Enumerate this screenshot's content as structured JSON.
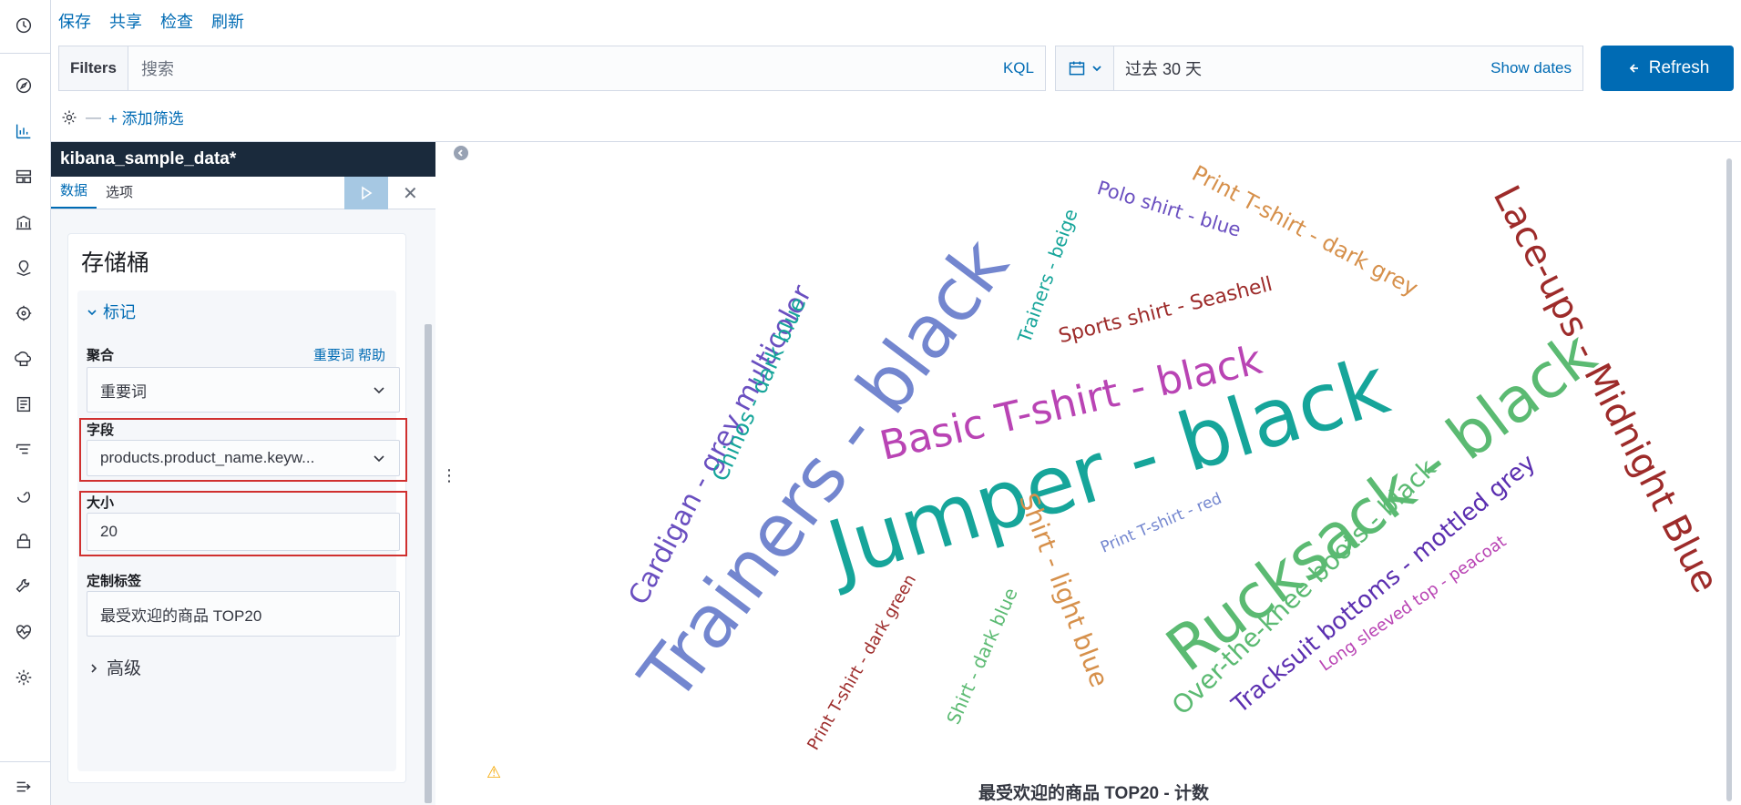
{
  "menu": {
    "save": "保存",
    "share": "共享",
    "inspect": "检查",
    "refresh": "刷新"
  },
  "query": {
    "filters_label": "Filters",
    "search_placeholder": "搜索",
    "kql": "KQL"
  },
  "date": {
    "range": "过去 30 天",
    "show_dates": "Show dates"
  },
  "refresh_button": "Refresh",
  "filter_row": {
    "add_filter": "+ 添加筛选"
  },
  "sidebar": {
    "title": "kibana_sample_data*",
    "tabs": [
      "数据",
      "选项"
    ],
    "section_title": "存储桶",
    "accordion": "标记",
    "aggregation": {
      "label": "聚合",
      "help_link": "重要词 帮助",
      "value": "重要词"
    },
    "field": {
      "label": "字段",
      "value": "products.product_name.keyw..."
    },
    "size": {
      "label": "大小",
      "value": "20"
    },
    "custom_label": {
      "label": "定制标签",
      "value": "最受欢迎的商品 TOP20"
    },
    "advanced": "高级"
  },
  "chart_data": {
    "type": "tagcloud",
    "title": "最受欢迎的商品 TOP20 - 计数",
    "tags": [
      {
        "text": "Jumper - black",
        "color": "#16a59a"
      },
      {
        "text": "Trainers - black",
        "color": "#7386cf"
      },
      {
        "text": "Rucksack - black",
        "color": "#5bba72"
      },
      {
        "text": "Lace-ups - Midnight Blue",
        "color": "#9d2b2a"
      },
      {
        "text": "Basic T-shirt - black",
        "color": "#b944b4"
      },
      {
        "text": "Cardigan - grey multicolor",
        "color": "#6a4fc0"
      },
      {
        "text": "Over-the-knee boots - black",
        "color": "#5bba72"
      },
      {
        "text": "Tracksuit bottoms - mottled grey",
        "color": "#5b2fb0"
      },
      {
        "text": "Shirt - light blue",
        "color": "#d6904b"
      },
      {
        "text": "Chinos - dark blue",
        "color": "#16a59a"
      },
      {
        "text": "Print T-shirt - dark grey",
        "color": "#d6904b"
      },
      {
        "text": "Sports shirt - Seashell",
        "color": "#9d2b2a"
      },
      {
        "text": "Polo shirt - blue",
        "color": "#6a4fc0"
      },
      {
        "text": "Trainers - beige",
        "color": "#16a59a"
      },
      {
        "text": "Shirt - dark blue",
        "color": "#5bba72"
      },
      {
        "text": "Print T-shirt - dark green",
        "color": "#9d2b2a"
      },
      {
        "text": "Long sleeved top - peacoat",
        "color": "#b944b4"
      },
      {
        "text": "Print T-shirt - red",
        "color": "#7386cf"
      }
    ]
  }
}
